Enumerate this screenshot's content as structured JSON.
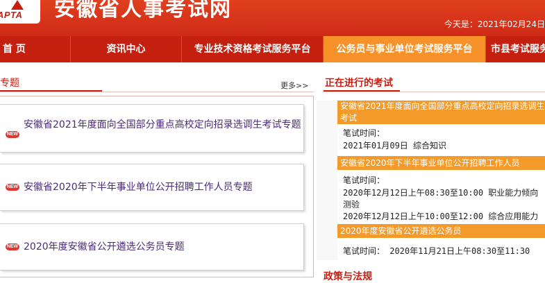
{
  "header": {
    "logo_text": "APTA",
    "site_title": "安徽省人事考试网",
    "today_text": "今天是：2021年02月24日"
  },
  "nav": {
    "items": [
      {
        "label": "首  页"
      },
      {
        "label": "资讯中心"
      },
      {
        "label": "专业技术资格考试服务平台"
      },
      {
        "label": "公务员与事业单位考试服务平台"
      },
      {
        "label": "市县考试服务"
      }
    ]
  },
  "topics": {
    "title": "专题",
    "more": "更多>>",
    "badge": "NEW",
    "items": [
      {
        "label": "安徽省2021年度面向全国部分重点高校定向招录选调生考试专题"
      },
      {
        "label": "安徽省2020年下半年事业单位公开招聘工作人员专题"
      },
      {
        "label": "2020年度安徽省公开遴选公务员专题"
      }
    ]
  },
  "exams": {
    "title": "正在进行的考试",
    "items": [
      {
        "name": "安徽省2021年度面向全国部分重点高校定向招录选调生考试",
        "name_line1": "安徽省2021年度面向全国部分重点高校定向招录选调生",
        "name_line2": "考试",
        "written_label": "笔试时间：",
        "lines": [
          "2021年01月09日  综合知识"
        ]
      },
      {
        "name": "安徽省2020年下半年事业单位公开招聘工作人员",
        "written_label": "笔试时间：",
        "lines": [
          "2020年12月12日上午08:30至10:00  职业能力倾向",
          "测验",
          "2020年12月12日上午10:00至12:00  综合应用能力"
        ]
      },
      {
        "name": "2020年度安徽省公开遴选公务员",
        "lines": [
          "笔试时间：  2020年11月21日上午08:30至11:30"
        ]
      }
    ]
  },
  "policy": {
    "title": "政策与法规"
  }
}
